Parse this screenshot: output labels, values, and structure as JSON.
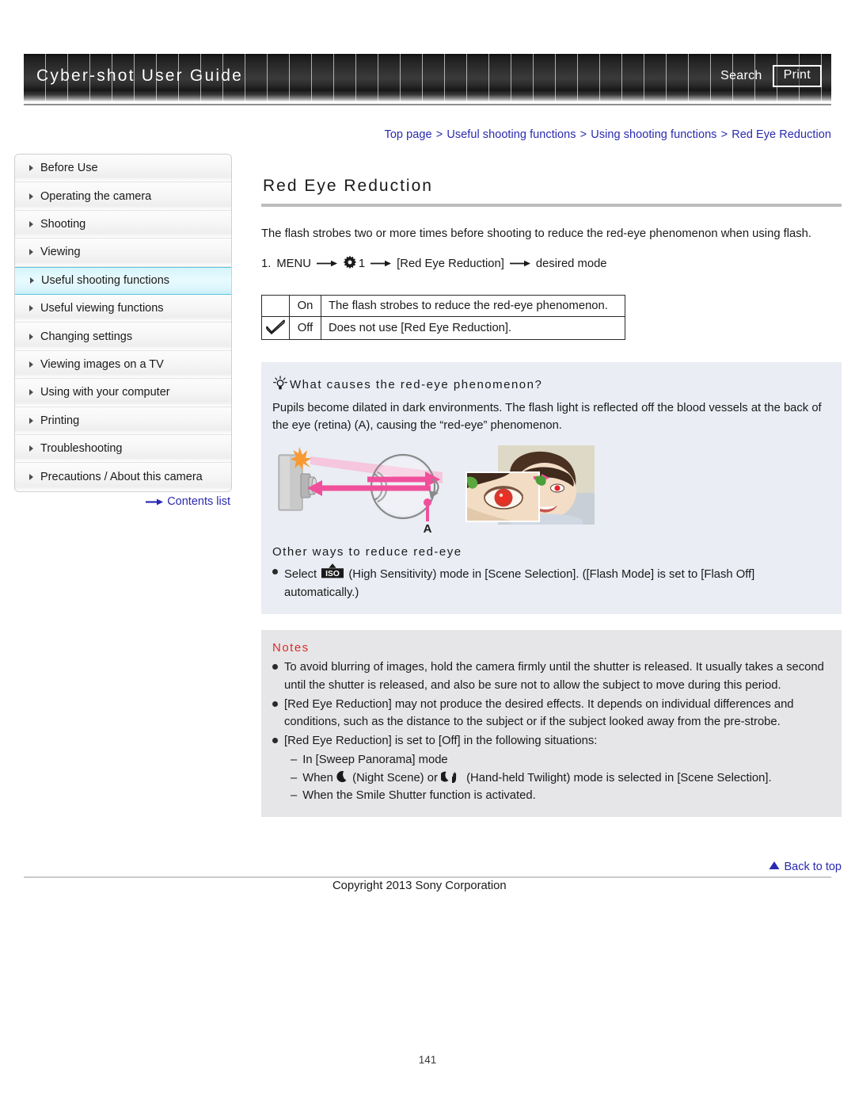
{
  "header": {
    "title": "Cyber-shot User Guide",
    "search_label": "Search",
    "print_label": "Print"
  },
  "breadcrumb": {
    "items": [
      "Top page",
      "Useful shooting functions",
      "Using shooting functions",
      "Red Eye Reduction"
    ],
    "separator": ">"
  },
  "sidebar": {
    "items": [
      {
        "label": "Before Use",
        "active": false
      },
      {
        "label": "Operating the camera",
        "active": false
      },
      {
        "label": "Shooting",
        "active": false
      },
      {
        "label": "Viewing",
        "active": false
      },
      {
        "label": "Useful shooting functions",
        "active": true
      },
      {
        "label": "Useful viewing functions",
        "active": false
      },
      {
        "label": "Changing settings",
        "active": false
      },
      {
        "label": "Viewing images on a TV",
        "active": false
      },
      {
        "label": "Using with your computer",
        "active": false
      },
      {
        "label": "Printing",
        "active": false
      },
      {
        "label": "Troubleshooting",
        "active": false
      },
      {
        "label": "Precautions / About this camera",
        "active": false
      }
    ],
    "contents_list_label": "Contents list"
  },
  "main": {
    "title": "Red Eye Reduction",
    "intro": "The flash strobes two or more times before shooting to reduce the red-eye phenomenon when using flash.",
    "step": {
      "number": "1.",
      "menu_label": "MENU",
      "gear_icon": "gear-icon",
      "tab_number": "1",
      "setting_label": "[Red Eye Reduction]",
      "result_label": "desired mode",
      "arrow": "→"
    },
    "options_table": {
      "rows": [
        {
          "checked": false,
          "name": "On",
          "description": "The flash strobes to reduce the red-eye phenomenon."
        },
        {
          "checked": true,
          "name": "Off",
          "description": "Does not use [Red Eye Reduction]."
        }
      ]
    },
    "hint": {
      "icon": "lightbulb-icon",
      "heading": "What causes the red-eye phenomenon?",
      "body": "Pupils become dilated in dark environments. The flash light is reflected off the blood vessels at the back of the eye (retina) (A), causing the “red-eye” phenomenon.",
      "illustration_label": "A"
    },
    "other_ways": {
      "heading": "Other ways to reduce red-eye",
      "bullet_pre": "Select",
      "iso_icon": "iso-icon",
      "bullet_post": "(High Sensitivity) mode in [Scene Selection]. ([Flash Mode] is set to [Flash Off] automatically.)"
    },
    "notes": {
      "heading": "Notes",
      "items": [
        "To avoid blurring of images, hold the camera firmly until the shutter is released. It usually takes a second until the shutter is released, and also be sure not to allow the subject to move during this period.",
        "[Red Eye Reduction] may not produce the desired effects. It depends on individual differences and conditions, such as the distance to the subject or if the subject looked away from the pre-strobe.",
        "[Red Eye Reduction] is set to [Off] in the following situations:"
      ],
      "sub_items": [
        {
          "pre": "In [Sweep Panorama] mode",
          "icon": "",
          "post": ""
        },
        {
          "pre": "When",
          "icon": "night-scene-icon",
          "post": "(Night Scene) or",
          "icon2": "handheld-twilight-icon",
          "post2": "(Hand-held Twilight) mode is selected in [Scene Selection]."
        },
        {
          "pre": "When the Smile Shutter function is activated.",
          "icon": "",
          "post": ""
        }
      ],
      "dash": "–"
    }
  },
  "footer": {
    "back_to_top_label": "Back to top",
    "copyright": "Copyright 2013 Sony Corporation",
    "page_number": "141"
  },
  "colors": {
    "link": "#2a2ab0",
    "notes_heading": "#d92b2b",
    "hint_panel_bg": "#eaedf4",
    "notes_panel_bg": "#e6e6e8",
    "sidebar_active_border": "#5fc6df",
    "header_text": "#ffffff",
    "illustration_accent": "#f0509b"
  }
}
